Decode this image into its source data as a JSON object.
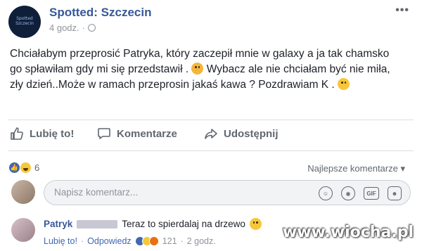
{
  "post": {
    "page_name": "Spotted: Szczecin",
    "time": "4 godz.",
    "separator": "·",
    "more_label": "•••",
    "text_parts": [
      "Chciałabym przeprosić Patryka, który zaczepił mnie w galaxy a ja tak chamsko go spławiłam gdy mi się przedstawił . ",
      " Wybacz ale nie chciałam być nie miła, zły dzień..Może w ramach przeprosin jakaś kawa ? Pozdrawiam K . "
    ]
  },
  "actions": {
    "like": "Lubię to!",
    "comment": "Komentarze",
    "share": "Udostępnij"
  },
  "reactions": {
    "count": "6",
    "sort_label": "Najlepsze komentarze ▾"
  },
  "comment_input": {
    "placeholder": "Napisz komentarz...",
    "gif_label": "GIF"
  },
  "comment": {
    "author": "Patryk",
    "text": "Teraz to spierdalaj na drzewo",
    "reply_like": "Lubię to!",
    "separator": "·",
    "reply": "Odpowiedz",
    "reaction_count": "121",
    "time": "2 godz."
  },
  "watermark": "www.wiocha.pl",
  "colors": {
    "link": "#365899",
    "accent": "#4267b2",
    "muted": "#90949c"
  }
}
